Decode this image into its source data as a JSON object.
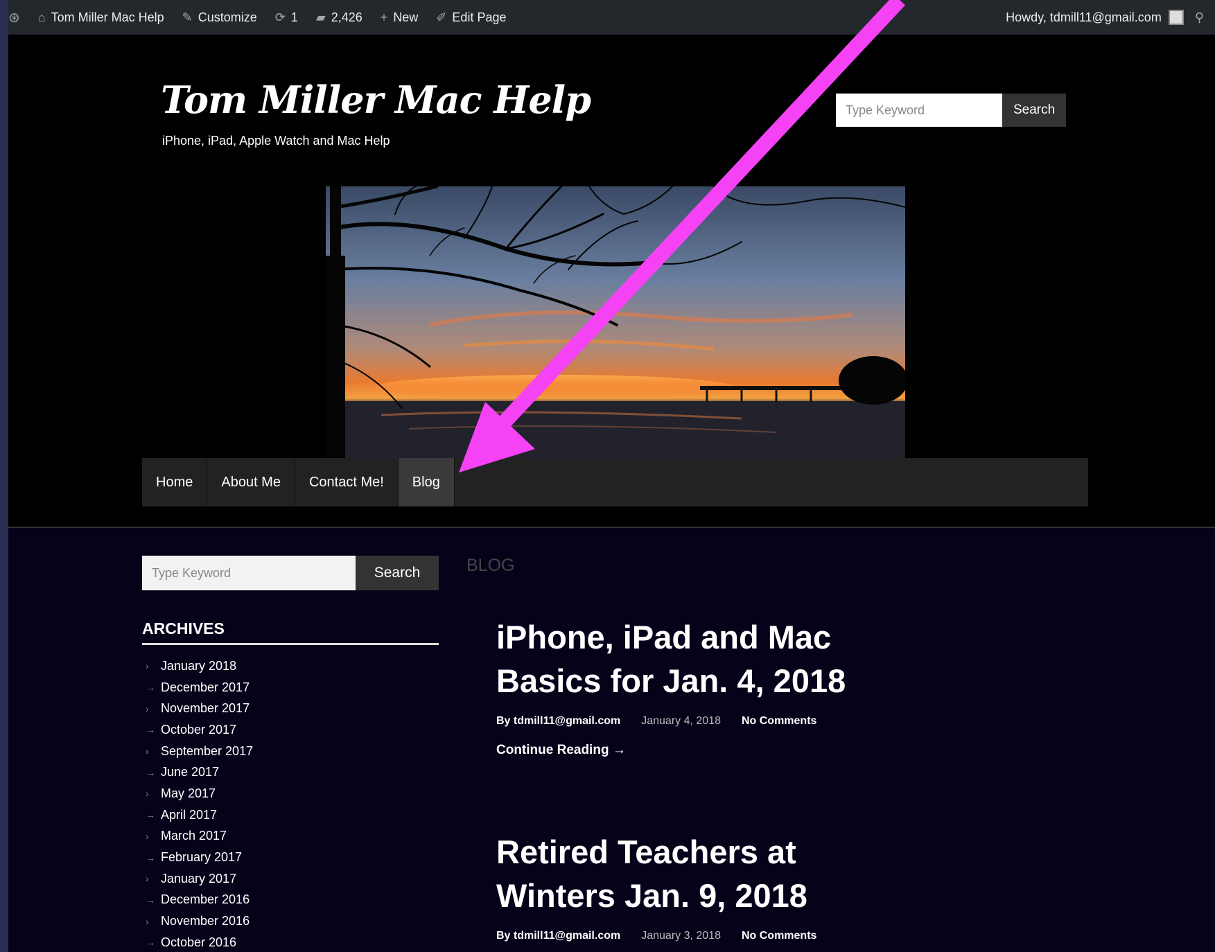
{
  "admin_bar": {
    "site_name": "Tom Miller Mac Help",
    "customize": "Customize",
    "updates_count": "1",
    "comments_count": "2,426",
    "new_label": "New",
    "edit_page": "Edit Page",
    "howdy": "Howdy, tdmill11@gmail.com"
  },
  "header": {
    "site_title": "Tom Miller Mac Help",
    "tagline": "iPhone, iPad, Apple Watch and Mac Help",
    "search_placeholder": "Type Keyword",
    "search_button": "Search"
  },
  "nav": {
    "items": [
      {
        "label": "Home"
      },
      {
        "label": "About Me"
      },
      {
        "label": "Contact Me!"
      },
      {
        "label": "Blog"
      }
    ],
    "active": "Blog"
  },
  "sidebar": {
    "search_placeholder": "Type Keyword",
    "search_button": "Search",
    "archives_title": "ARCHIVES",
    "archives": [
      "January 2018",
      "December 2017",
      "November 2017",
      "October 2017",
      "September 2017",
      "June 2017",
      "May 2017",
      "April 2017",
      "March 2017",
      "February 2017",
      "January 2017",
      "December 2016",
      "November 2016",
      "October 2016"
    ]
  },
  "main": {
    "section_label": "BLOG",
    "posts": [
      {
        "title": "iPhone, iPad and Mac Basics for Jan. 4, 2018",
        "author": "By tdmill11@gmail.com",
        "date": "January 4, 2018",
        "comments": "No Comments",
        "more": "Continue Reading →"
      },
      {
        "title": "Retired Teachers at Winters Jan. 9, 2018",
        "author": "By tdmill11@gmail.com",
        "date": "January 3, 2018",
        "comments": "No Comments"
      }
    ]
  },
  "colors": {
    "annotation_arrow": "#f542f5",
    "admin_bar": "#23282d",
    "page_background": "#04031a"
  }
}
